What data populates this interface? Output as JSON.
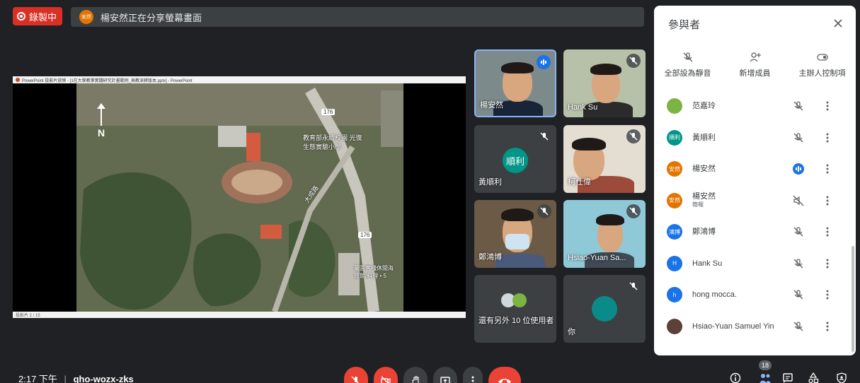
{
  "recording": {
    "label": "錄製中"
  },
  "share_banner": {
    "avatar_text": "安然",
    "text": "楊安然正在分享螢幕畫面"
  },
  "presentation": {
    "window_title": "PowerPoint 投影片放映 - [1在大學教學實踐研究計畫範例_高教深耕版本.pptx] - PowerPoint",
    "status": "投影片 2 / 15",
    "north_label": "N",
    "map_labels": {
      "school": "教育部永續校園 光復\n生態實驗小學",
      "road": "大成路",
      "park": "蘭園客棧休閒海\n旅館/料理 • 5",
      "road_no_1": "176",
      "road_no_2": "176"
    }
  },
  "tiles": [
    {
      "name": "楊安然",
      "speaking": true
    },
    {
      "name": "Hank Su",
      "muted": true
    },
    {
      "name": "黃順利",
      "avatar_text": "順利",
      "muted": true
    },
    {
      "name": "柯仕偉",
      "muted": true
    },
    {
      "name": "鄭鴻博",
      "muted": true
    },
    {
      "name": "Hsiao-Yuan Sa...",
      "muted": true
    },
    {
      "name": "還有另外 10 位使用者"
    },
    {
      "name": "你",
      "muted": true
    }
  ],
  "bottom_bar": {
    "time": "2:17 下午",
    "separator": "|",
    "meeting_code": "qho-wozx-zks",
    "people_count": "18"
  },
  "panel": {
    "title": "參與者",
    "actions": [
      {
        "label": "全部設為靜音",
        "icon": "mute-all-icon"
      },
      {
        "label": "新增成員",
        "icon": "add-person-icon"
      },
      {
        "label": "主辦人控制項",
        "icon": "host-controls-icon"
      }
    ],
    "participants": [
      {
        "name": "范嘉玲",
        "avatar_text": "",
        "color": "#7cb342",
        "state": "muted"
      },
      {
        "name": "黃順利",
        "avatar_text": "順利",
        "color": "#009688",
        "state": "muted"
      },
      {
        "name": "楊安然",
        "avatar_text": "安然",
        "color": "#e37400",
        "state": "speaking"
      },
      {
        "name": "楊安然",
        "sub": "簡報",
        "avatar_text": "安然",
        "color": "#e37400",
        "state": "presenting"
      },
      {
        "name": "鄭鴻博",
        "avatar_text": "鴻博",
        "color": "#1a73e8",
        "state": "muted"
      },
      {
        "name": "Hank Su",
        "avatar_text": "H",
        "color": "#1a73e8",
        "state": "muted"
      },
      {
        "name": "hong mocca.",
        "avatar_text": "h",
        "color": "#1a73e8",
        "state": "muted"
      },
      {
        "name": "Hsiao-Yuan Samuel Yin",
        "avatar_text": "",
        "color": "#5d4037",
        "state": "muted"
      }
    ]
  },
  "colors": {
    "accent": "#1a73e8",
    "danger": "#ea4335",
    "background": "#202124",
    "tile": "#3c4043"
  }
}
